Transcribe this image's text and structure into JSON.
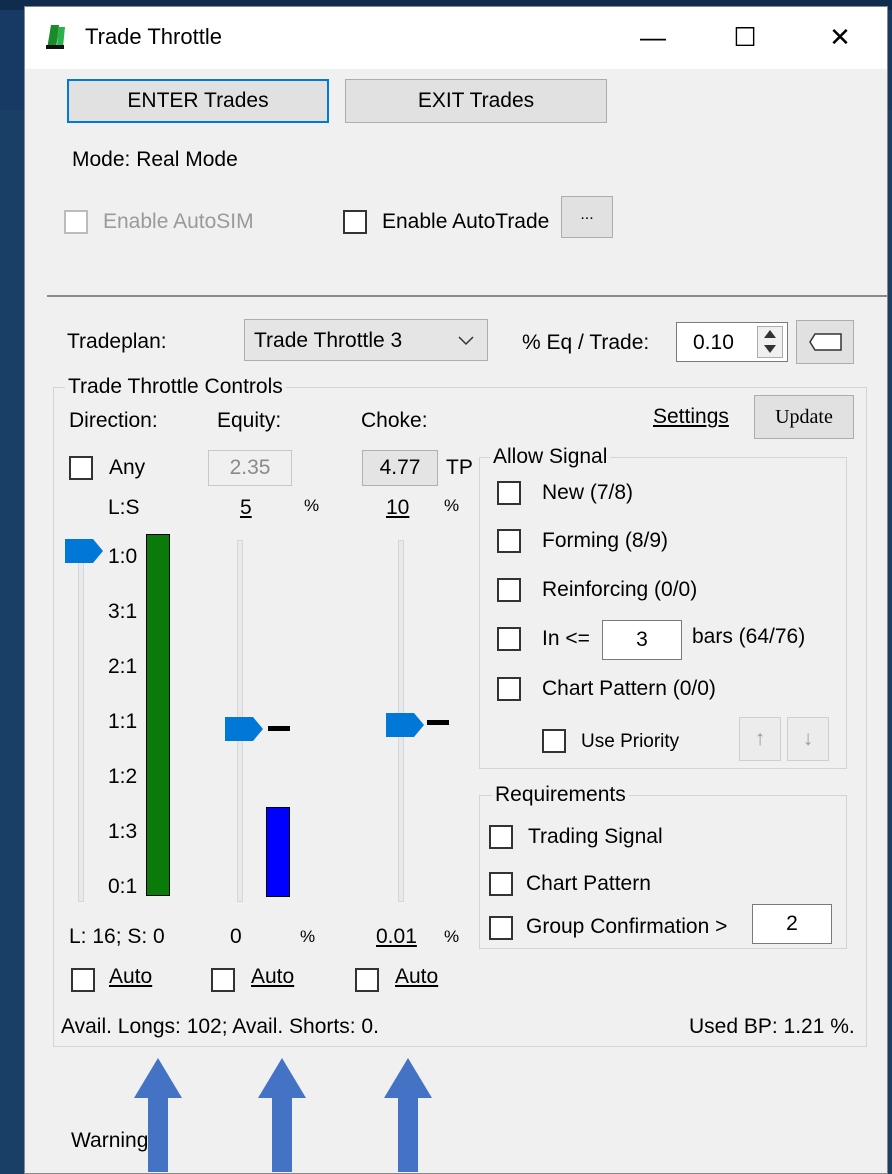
{
  "window": {
    "title": "Trade Throttle"
  },
  "titlebar": {
    "minimize": "—",
    "maximize": "☐",
    "close": "✕"
  },
  "buttons": {
    "enter": "ENTER Trades",
    "exit": "EXIT Trades",
    "ellipsis": "...",
    "settings": "Settings",
    "update": "Update"
  },
  "mode": "Mode: Real Mode",
  "options": {
    "autosim": "Enable AutoSIM",
    "autotrade": "Enable AutoTrade"
  },
  "tradeplan": {
    "label": "Tradeplan:",
    "value": "Trade Throttle 3"
  },
  "eq_trade": {
    "label": "% Eq / Trade:",
    "value": "0.10"
  },
  "controls": {
    "title": "Trade Throttle Controls",
    "direction": {
      "label": "Direction:",
      "any": "Any",
      "ratio_header": "L:S",
      "ticks": [
        "1:0",
        "3:1",
        "2:1",
        "1:1",
        "1:2",
        "1:3",
        "0:1"
      ],
      "summary": "L: 16; S: 0",
      "level": 1.0
    },
    "equity": {
      "label": "Equity:",
      "value": "2.35",
      "top": "5",
      "top_unit": "%",
      "bottom": "0",
      "bottom_unit": "%",
      "level": 0.5
    },
    "choke": {
      "label": "Choke:",
      "value": "4.77",
      "suffix": "TP",
      "top": "10",
      "top_unit": "%",
      "bottom": "0.01",
      "bottom_unit": "%",
      "level": 0.5
    },
    "auto": "Auto"
  },
  "allow_signal": {
    "title": "Allow Signal",
    "new": "New (7/8)",
    "forming": "Forming (8/9)",
    "reinforcing": "Reinforcing (0/0)",
    "in_prefix": "In <=",
    "in_value": "3",
    "in_suffix": "bars (64/76)",
    "chart_pattern": "Chart Pattern (0/0)",
    "use_priority": "Use Priority",
    "up": "↑",
    "down": "↓"
  },
  "requirements": {
    "title": "Requirements",
    "trading_signal": "Trading Signal",
    "chart_pattern": "Chart Pattern",
    "group_confirmation": "Group Confirmation >",
    "group_value": "2"
  },
  "status": {
    "avail": "Avail. Longs: 102; Avail. Shorts: 0.",
    "used_bp": "Used BP: 1.21 %."
  },
  "warning": "Warning:",
  "colors": {
    "long_bar": "#0a7a0a",
    "short_bar": "#0000ff",
    "thumb": "#0078d7",
    "arrow": "#4472c4"
  }
}
